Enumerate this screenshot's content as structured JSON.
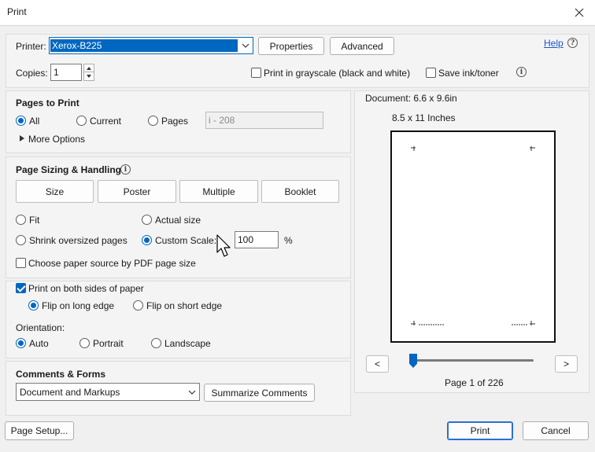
{
  "window": {
    "title": "Print",
    "close_label": "×"
  },
  "printer": {
    "label": "Printer:",
    "selected": "Xerox-B225",
    "properties_label": "Properties",
    "advanced_label": "Advanced",
    "help_label": "Help",
    "copies_label": "Copies:",
    "copies_value": "1",
    "grayscale_label": "Print in grayscale (black and white)",
    "save_ink_label": "Save ink/toner"
  },
  "pages_to_print": {
    "title": "Pages to Print",
    "all_label": "All",
    "current_label": "Current",
    "pages_label": "Pages",
    "pages_placeholder": "i - 208",
    "more_options_label": "More Options"
  },
  "sizing": {
    "title": "Page Sizing & Handling",
    "tabs": [
      "Size",
      "Poster",
      "Multiple",
      "Booklet"
    ],
    "fit_label": "Fit",
    "actual_size_label": "Actual size",
    "shrink_label": "Shrink oversized pages",
    "custom_scale_label": "Custom Scale:",
    "custom_scale_value": "100",
    "percent_label": "%",
    "paper_source_label": "Choose paper source by PDF page size"
  },
  "duplex": {
    "both_sides_label": "Print on both sides of paper",
    "long_edge_label": "Flip on long edge",
    "short_edge_label": "Flip on short edge",
    "orientation_label": "Orientation:",
    "auto_label": "Auto",
    "portrait_label": "Portrait",
    "landscape_label": "Landscape"
  },
  "comments": {
    "title": "Comments & Forms",
    "selected": "Document and Markups",
    "summarize_label": "Summarize Comments"
  },
  "preview": {
    "document_label": "Document: 6.6 x 9.6in",
    "paper_label": "8.5 x 11 Inches",
    "prev_label": "<",
    "next_label": ">",
    "page_status": "Page 1 of 226",
    "slider_fraction": 0.0
  },
  "footer": {
    "page_setup_label": "Page Setup...",
    "print_label": "Print",
    "cancel_label": "Cancel"
  },
  "colors": {
    "accent": "#0067c0",
    "link": "#1a55c7",
    "selection": "#0067c0"
  }
}
